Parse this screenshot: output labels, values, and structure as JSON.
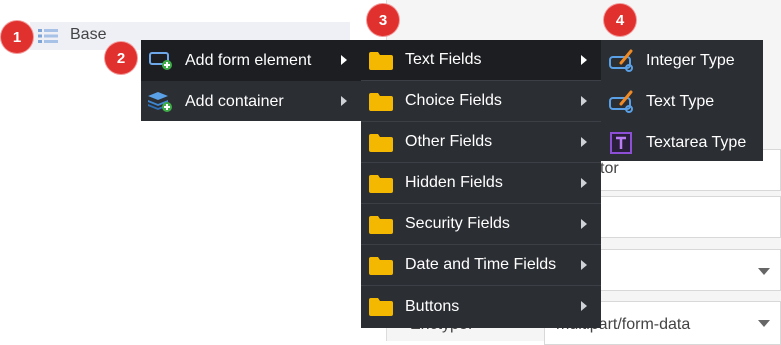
{
  "tree": {
    "root_label": "Base"
  },
  "properties": {
    "editor_text": "tor",
    "enctype_label": "Enctype:",
    "enctype_value": "multipart/form-data"
  },
  "menu_add": {
    "items": [
      {
        "label": "Add form element",
        "icon": "form-element-add-icon",
        "active": true
      },
      {
        "label": "Add container",
        "icon": "container-add-icon",
        "active": false
      }
    ]
  },
  "menu_categories": {
    "items": [
      {
        "label": "Text Fields",
        "icon": "folder-icon",
        "active": true
      },
      {
        "label": "Choice Fields",
        "icon": "folder-icon"
      },
      {
        "label": "Other Fields",
        "icon": "folder-icon"
      },
      {
        "label": "Hidden Fields",
        "icon": "folder-icon"
      },
      {
        "label": "Security Fields",
        "icon": "folder-icon"
      },
      {
        "label": "Date and Time Fields",
        "icon": "folder-icon"
      },
      {
        "label": "Buttons",
        "icon": "folder-icon"
      }
    ]
  },
  "menu_types": {
    "items": [
      {
        "label": "Integer Type",
        "icon": "input-type-icon"
      },
      {
        "label": "Text Type",
        "icon": "input-type-icon"
      },
      {
        "label": "Textarea Type",
        "icon": "textarea-type-icon"
      }
    ]
  },
  "step_badges": [
    "1",
    "2",
    "3",
    "4"
  ],
  "colors": {
    "menu_bg": "#2b2e33",
    "menu_active": "#1c1e22",
    "badge": "#e0312f",
    "folder": "#f5b800"
  }
}
